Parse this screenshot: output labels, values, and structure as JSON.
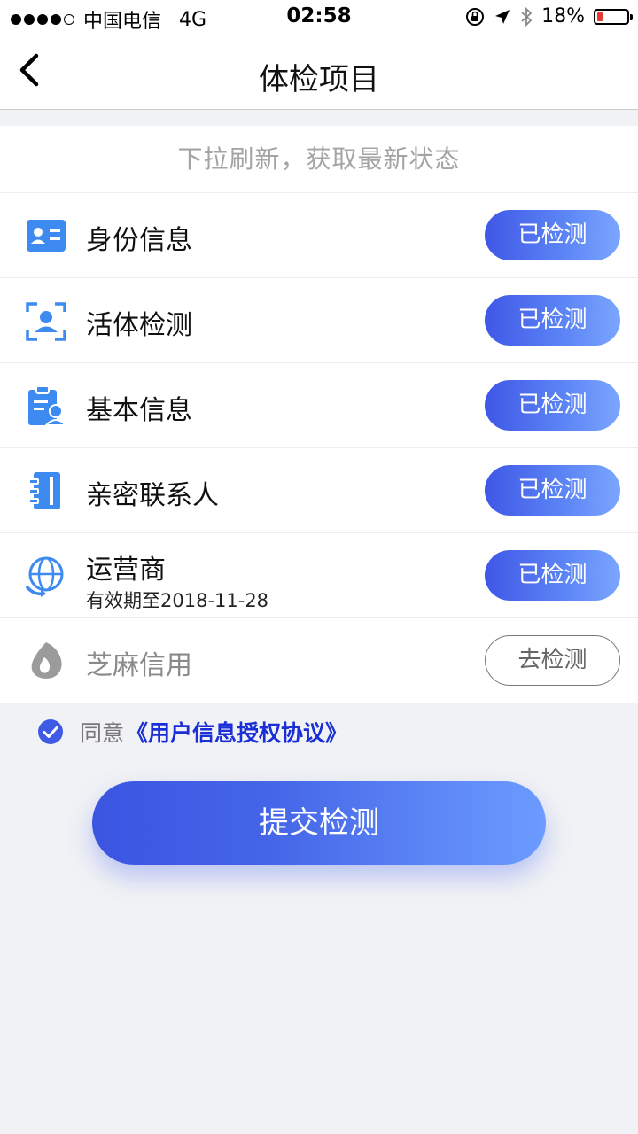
{
  "status_bar": {
    "carrier": "中国电信",
    "network": "4G",
    "time": "02:58",
    "battery_percent": "18%",
    "battery_level": 0.18,
    "battery_color": "#e53935"
  },
  "nav": {
    "back_icon": "chevron-left-icon",
    "title": "体检项目"
  },
  "refresh_hint": "下拉刷新，获取最新状态",
  "items": [
    {
      "name": "身份信息",
      "subtitle": "",
      "status": "已检测",
      "icon": "id-card-icon",
      "checked": true
    },
    {
      "name": "活体检测",
      "subtitle": "",
      "status": "已检测",
      "icon": "face-scan-icon",
      "checked": true
    },
    {
      "name": "基本信息",
      "subtitle": "",
      "status": "已检测",
      "icon": "profile-form-icon",
      "checked": true
    },
    {
      "name": "亲密联系人",
      "subtitle": "",
      "status": "已检测",
      "icon": "contacts-book-icon",
      "checked": true
    },
    {
      "name": "运营商",
      "subtitle": "有效期至2018-11-28",
      "status": "已检测",
      "icon": "globe-refresh-icon",
      "checked": true
    },
    {
      "name": "芝麻信用",
      "subtitle": "",
      "status": "去检测",
      "icon": "sesame-icon",
      "checked": false
    }
  ],
  "agreement": {
    "prefix": "同意",
    "link": "《用户信息授权协议》",
    "checked": true
  },
  "submit_label": "提交检测",
  "colors": {
    "accent_start": "#3f57e6",
    "accent_end": "#7ba6ff",
    "icon_blue": "#3d8bf0",
    "link": "#1b2fd6"
  }
}
